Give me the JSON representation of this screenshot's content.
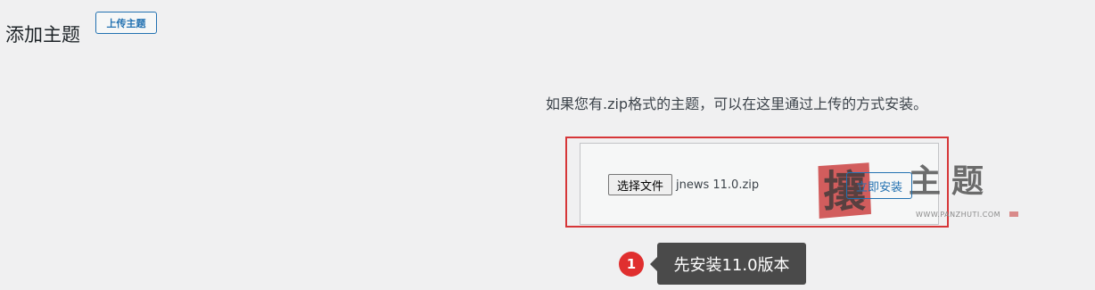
{
  "header": {
    "title": "添加主题",
    "upload_button_label": "上传主题"
  },
  "upload": {
    "help_text": "如果您有.zip格式的主题，可以在这里通过上传的方式安装。",
    "choose_file_label": "选择文件",
    "selected_file": "jnews 11.0.zip",
    "install_button_label": "立即安装"
  },
  "watermark": {
    "text": "主题",
    "url": "WWW.PANZHUTI.COM",
    "seal_char": "攘"
  },
  "annotation": {
    "step_number": "1",
    "callout_text": "先安装11.0版本",
    "highlight_color": "#d63638"
  },
  "colors": {
    "accent": "#2271b1",
    "background": "#f0f0f1",
    "step_badge": "#e02f2f",
    "callout_bg": "#4a4a4a"
  }
}
